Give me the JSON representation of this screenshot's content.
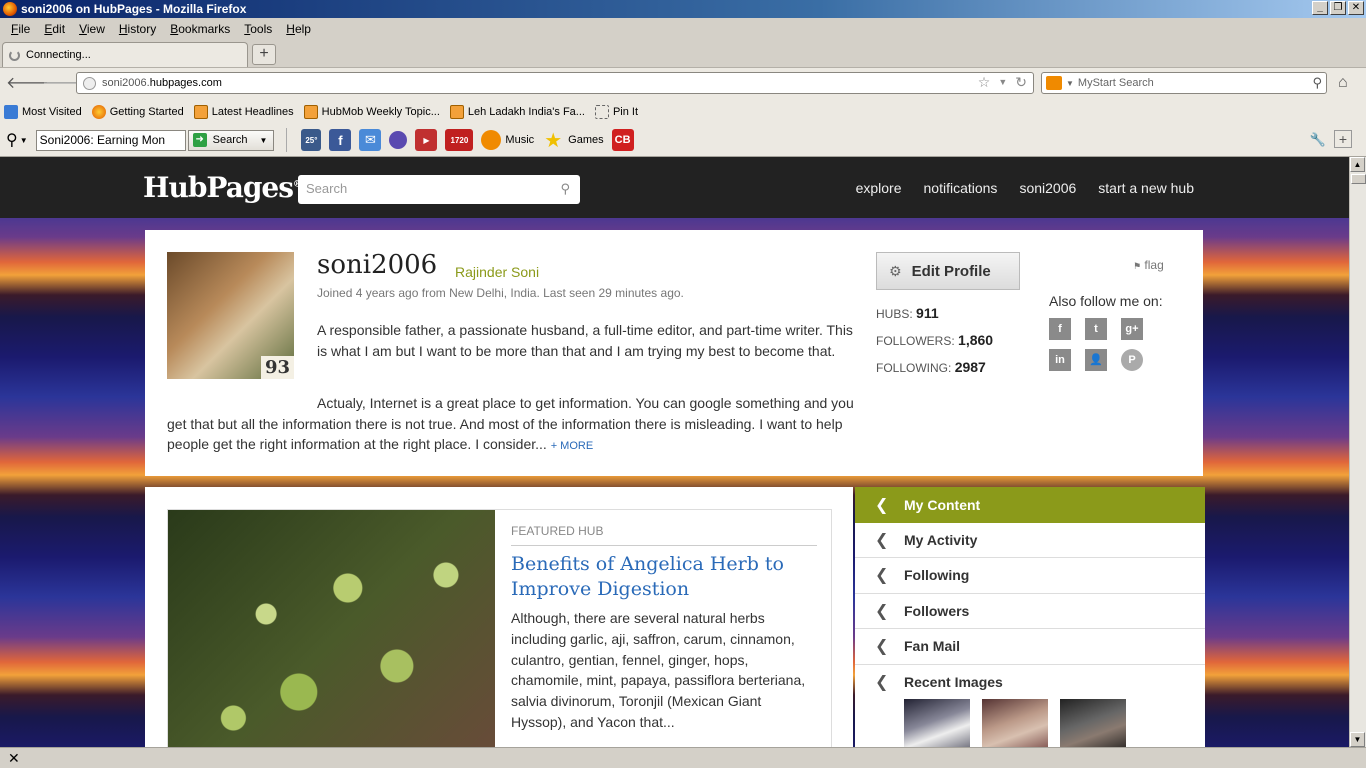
{
  "window": {
    "title": "soni2006 on HubPages - Mozilla Firefox",
    "controls": [
      "_",
      "❐",
      "✕"
    ]
  },
  "menu": {
    "items": [
      {
        "accel": "F",
        "rest": "ile"
      },
      {
        "accel": "E",
        "rest": "dit"
      },
      {
        "accel": "V",
        "rest": "iew"
      },
      {
        "accel": "H",
        "rest": "istory"
      },
      {
        "accel": "B",
        "rest": "ookmarks"
      },
      {
        "accel": "T",
        "rest": "ools"
      },
      {
        "accel": "H",
        "rest": "elp"
      }
    ]
  },
  "tabs": {
    "active_label": "Connecting...",
    "new_tab": "+"
  },
  "nav": {
    "url_prefix": "soni2006.",
    "url_domain": "hubpages.com",
    "search_placeholder": "MyStart Search"
  },
  "bookmarks": [
    {
      "label": "Most Visited",
      "icon": "blue"
    },
    {
      "label": "Getting Started",
      "icon": "ff"
    },
    {
      "label": "Latest Headlines",
      "icon": "rss"
    },
    {
      "label": "HubMob Weekly Topic...",
      "icon": "rss"
    },
    {
      "label": "Leh Ladakh India's Fa...",
      "icon": "rss"
    },
    {
      "label": "Pin It",
      "icon": "dash"
    }
  ],
  "toolbar": {
    "select_value": "Soni2006: Earning Mon",
    "search_label": "Search",
    "weather": "25°",
    "badge_1720": "1720",
    "music_label": "Music",
    "games_label": "Games",
    "cb_label": "CB"
  },
  "hubpages": {
    "logo": "HubPages",
    "search_placeholder": "Search",
    "nav": [
      "explore",
      "notifications",
      "soni2006",
      "start a new hub"
    ]
  },
  "profile": {
    "username": "soni2006",
    "real_name": "Rajinder Soni",
    "joined": "Joined 4 years ago from New Delhi, India. Last seen 29 minutes ago.",
    "score": "93",
    "bio_1": "A responsible father, a passionate husband, a full-time editor, and part-time writer. This is what I am but I want to be more than that and I am trying my best to become that.",
    "bio_2": "Actualy, Internet is a great place to get information. You can google something and you get that but all the information there is not true. And most of the information there is misleading. I want to help people get the right information at the right place. I consider...",
    "more": "+ MORE",
    "edit_profile": "Edit Profile",
    "flag": "flag",
    "hubs_label": "HUBS:",
    "hubs": "911",
    "followers_label": "FOLLOWERS:",
    "followers": "1,860",
    "following_label": "FOLLOWING:",
    "following": "2987",
    "follow_label": "Also follow me on:"
  },
  "featured": {
    "label": "FEATURED HUB",
    "title": "Benefits of Angelica Herb to Improve Digestion",
    "desc": "Although, there are several natural herbs including garlic, aji, saffron, carum, cinnamon, culantro, gentian, fennel, ginger, hops, chamomile, mint, papaya, passiflora berteriana, salvia divinorum, Toronjil (Mexican Giant Hyssop), and Yacon that..."
  },
  "sidemenu": {
    "items": [
      "My Content",
      "My Activity",
      "Following",
      "Followers",
      "Fan Mail",
      "Recent Images"
    ]
  },
  "status": {
    "close": "✕"
  }
}
